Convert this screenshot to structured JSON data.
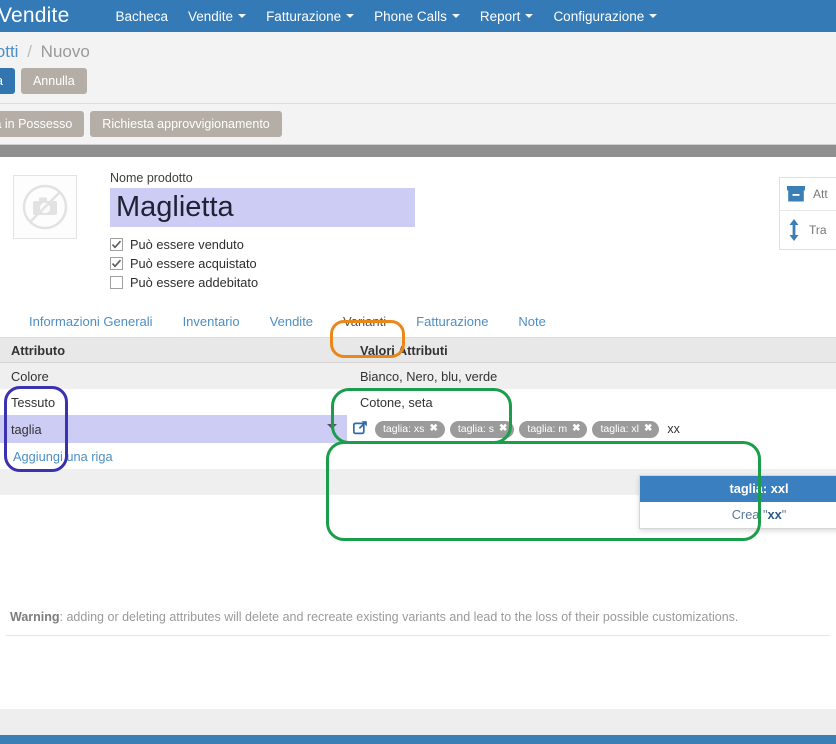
{
  "navbar": {
    "brand": "Vendite",
    "items": [
      {
        "label": "Bacheca",
        "caret": false
      },
      {
        "label": "Vendite",
        "caret": true
      },
      {
        "label": "Fatturazione",
        "caret": true
      },
      {
        "label": "Phone Calls",
        "caret": true
      },
      {
        "label": "Report",
        "caret": true
      },
      {
        "label": "Configurazione",
        "caret": true
      }
    ]
  },
  "breadcrumb": {
    "parent": "lotti",
    "separator": "/",
    "current": "Nuovo"
  },
  "toolbar": {
    "save_label": "a",
    "cancel_label": "Annulla"
  },
  "actionbar": {
    "update_qty_label": "iorna Qtà in Possesso",
    "replenish_label": "Richiesta approvvigionamento"
  },
  "product": {
    "name_label": "Nome prodotto",
    "name_value": "Maglietta",
    "image_icon": "no-camera-icon",
    "checkboxes": [
      {
        "label": "Può essere venduto",
        "checked": true
      },
      {
        "label": "Può essere acquistato",
        "checked": true
      },
      {
        "label": "Può essere addebitato",
        "checked": false
      }
    ]
  },
  "side_buttons": [
    {
      "icon": "box-icon",
      "label": "Att"
    },
    {
      "icon": "updown-arrow-icon",
      "label": "Tra"
    }
  ],
  "tabs": [
    {
      "label": "Informazioni Generali",
      "active": false
    },
    {
      "label": "Inventario",
      "active": false
    },
    {
      "label": "Vendite",
      "active": false
    },
    {
      "label": "Varianti",
      "active": true
    },
    {
      "label": "Fatturazione",
      "active": false
    },
    {
      "label": "Note",
      "active": false
    }
  ],
  "attributes_table": {
    "headers": [
      "Attributo",
      "Valori Attributi"
    ],
    "rows": [
      {
        "attribute": "Colore",
        "values": "Bianco, Nero, blu, verde"
      },
      {
        "attribute": "Tessuto",
        "values": "Cotone, seta"
      }
    ],
    "active_row": {
      "attribute": "taglia",
      "chips": [
        "taglia: xs",
        "taglia: s",
        "taglia: m",
        "taglia: xl"
      ],
      "chip_remove_glyph": "✖",
      "typed_text": "xx",
      "external_link_icon": "external-link-icon"
    },
    "add_row_label": "Aggiungi una riga"
  },
  "dropdown": {
    "options": [
      {
        "label": "taglia: xxl",
        "selected": true
      },
      {
        "label_prefix": "Crea ",
        "quoted": "xx",
        "selected": false
      }
    ]
  },
  "warning": {
    "prefix": "Warning",
    "text": ": adding or deleting attributes will delete and recreate existing variants and lead to the loss of their possible customizations."
  },
  "colors": {
    "navbar_blue": "#337ab7",
    "primary_button": "#3276b1",
    "default_button": "#b4aea6",
    "active_row_lavender": "#ccccf5",
    "dropdown_selected": "#3a80c0",
    "highlight_orange": "#e8871a",
    "highlight_blue": "#3a32b0",
    "highlight_green": "#1a9e4b",
    "link_blue": "#4d8fc4"
  }
}
